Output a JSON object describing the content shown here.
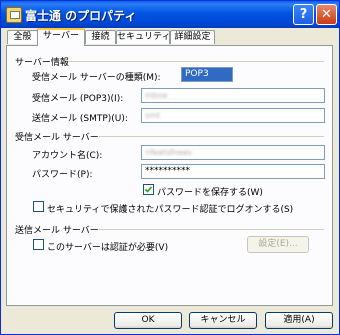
{
  "window": {
    "title": "富士通 のプロパティ"
  },
  "titlebar": {
    "help_glyph": "?",
    "close_glyph": "✕"
  },
  "tabs": [
    {
      "label": "全般"
    },
    {
      "label": "サーバー"
    },
    {
      "label": "接続"
    },
    {
      "label": "セキュリティ"
    },
    {
      "label": "詳細設定"
    }
  ],
  "server_info": {
    "heading": "サーバー情報",
    "server_type_label": "受信メール サーバーの種類(M):",
    "server_type_value": "POP3",
    "incoming_label": "受信メール (POP3)(I):",
    "incoming_value": "mboe",
    "outgoing_label": "送信メール (SMTP)(U):",
    "outgoing_value": "smt"
  },
  "incoming_server": {
    "heading": "受信メール サーバー",
    "account_label": "アカウント名(C):",
    "account_value": "nfeatsfnees",
    "password_label": "パスワード(P):",
    "password_value": "**********",
    "save_password_label": "パスワードを保存する(W)",
    "spa_label": "セキュリティで保護されたパスワード認証でログオンする(S)"
  },
  "outgoing_server": {
    "heading": "送信メール サーバー",
    "auth_label": "このサーバーは認証が必要(V)",
    "settings_label": "設定(E)..."
  },
  "footer": {
    "ok": "OK",
    "cancel": "キャンセル",
    "apply": "適用(A)"
  }
}
